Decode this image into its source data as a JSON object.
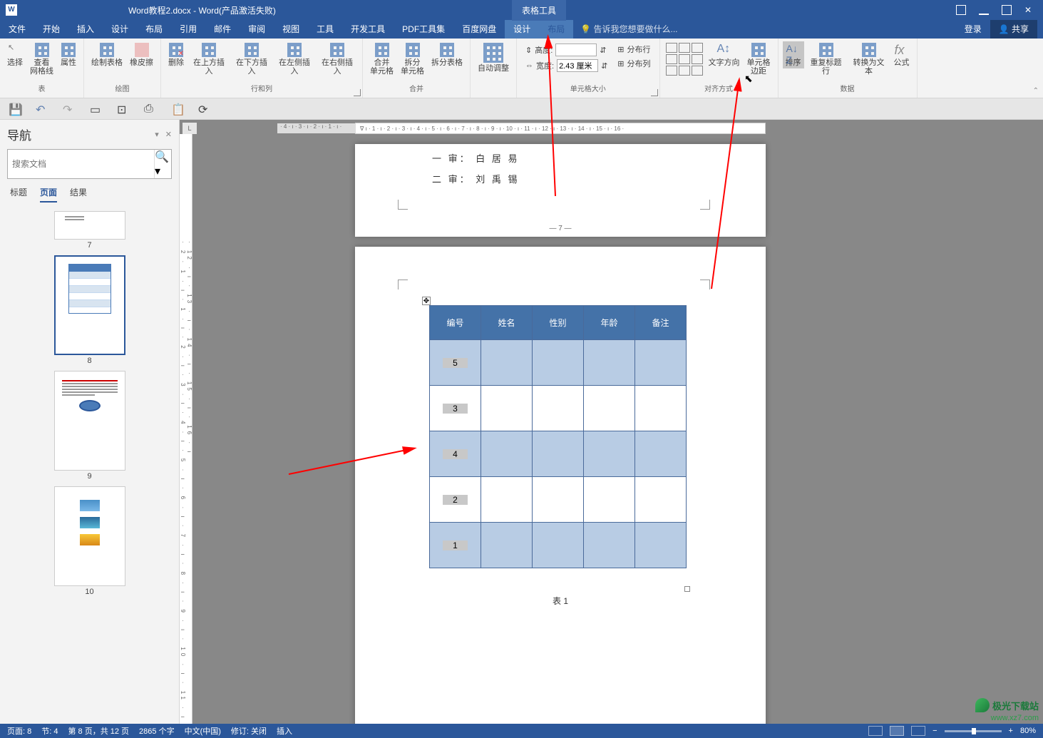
{
  "titlebar": {
    "doc_title": "Word教程2.docx - Word(产品激活失败)",
    "table_tools": "表格工具"
  },
  "menubar": {
    "tabs": [
      "文件",
      "开始",
      "插入",
      "设计",
      "布局",
      "引用",
      "邮件",
      "审阅",
      "视图",
      "工具",
      "开发工具",
      "PDF工具集",
      "百度网盘"
    ],
    "context_tabs": [
      "设计",
      "布局"
    ],
    "tell_me": "告诉我您想要做什么...",
    "login": "登录",
    "share": "共享"
  },
  "ribbon": {
    "groups": {
      "table": {
        "label": "表",
        "select": "选择",
        "view_grid": "查看\n网格线",
        "properties": "属性"
      },
      "draw": {
        "label": "绘图",
        "draw_table": "绘制表格",
        "eraser": "橡皮擦"
      },
      "rows_cols": {
        "label": "行和列",
        "delete": "删除",
        "insert_above": "在上方插入",
        "insert_below": "在下方插入",
        "insert_left": "在左侧插入",
        "insert_right": "在右侧插入"
      },
      "merge": {
        "label": "合并",
        "merge_cells": "合并\n单元格",
        "split_cells": "拆分\n单元格",
        "split_table": "拆分表格"
      },
      "autofit": {
        "label": "",
        "autofit": "自动调整"
      },
      "cell_size": {
        "label": "单元格大小",
        "height_label": "高度:",
        "height_value": "",
        "width_label": "宽度:",
        "width_value": "2.43 厘米",
        "dist_rows": "分布行",
        "dist_cols": "分布列"
      },
      "alignment": {
        "label": "对齐方式",
        "text_dir": "文字方向",
        "cell_margins": "单元格\n边距"
      },
      "data": {
        "label": "数据",
        "sort": "排序",
        "repeat_header": "重复标题行",
        "to_text": "转换为文本",
        "formula": "公式"
      }
    }
  },
  "nav": {
    "title": "导航",
    "search_placeholder": "搜索文档",
    "tabs": [
      "标题",
      "页面",
      "结果"
    ],
    "pages": [
      "7",
      "8",
      "9",
      "10"
    ]
  },
  "document": {
    "line1": "一 审： 白 居 易",
    "line2": "二 审： 刘 禹 锡",
    "page7_num": "— 7 —",
    "table_headers": [
      "编号",
      "姓名",
      "性别",
      "年龄",
      "备注"
    ],
    "table_rows": [
      "5",
      "3",
      "4",
      "2",
      "1"
    ],
    "table_caption": "表 1"
  },
  "statusbar": {
    "page": "页面: 8",
    "section": "节: 4",
    "page_of": "第 8 页，共 12 页",
    "words": "2865 个字",
    "language": "中文(中国)",
    "track": "修订: 关闭",
    "insert": "插入",
    "zoom": "80%"
  },
  "watermark": {
    "name": "极光下载站",
    "url": "www.xz7.com"
  }
}
